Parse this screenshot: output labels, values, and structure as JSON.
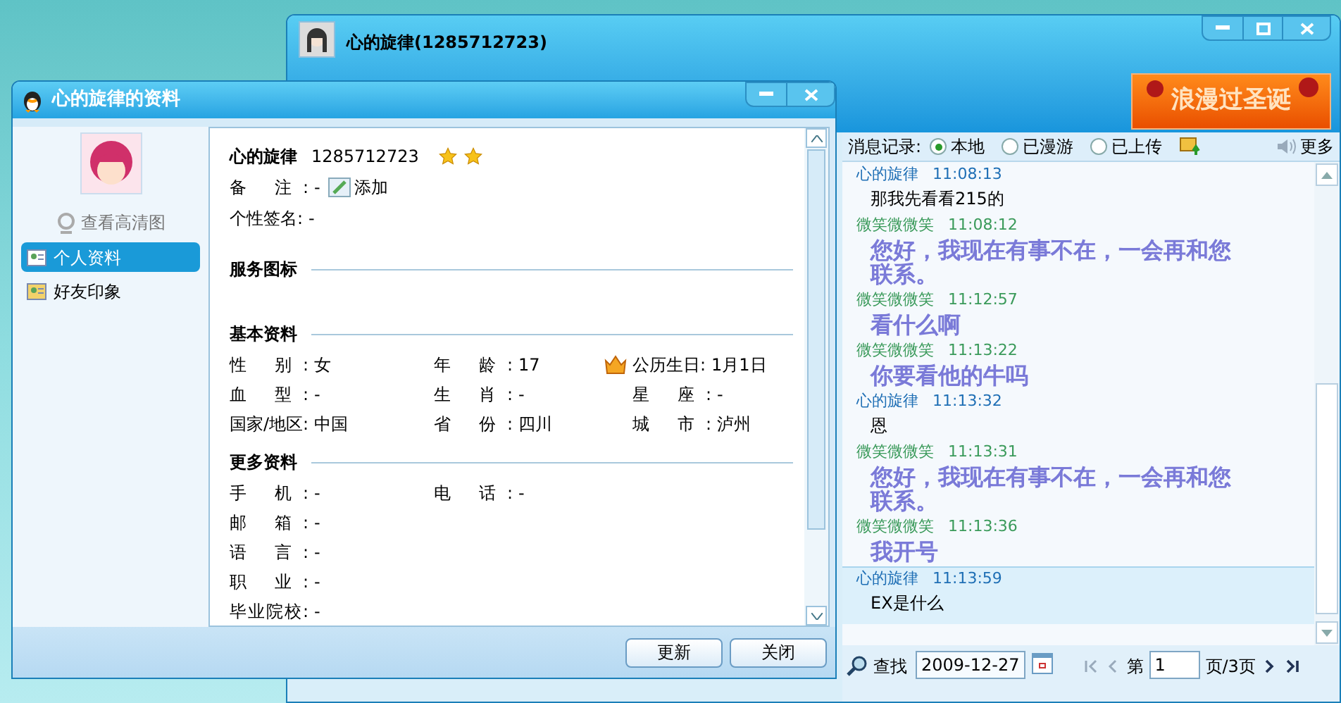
{
  "chat_window": {
    "title": "心的旋律(1285712723)",
    "banner": "浪漫过圣诞",
    "history_bar": {
      "label": "消息记录:",
      "sources": [
        {
          "label": "本地",
          "selected": true
        },
        {
          "label": "已漫游",
          "selected": false
        },
        {
          "label": "已上传",
          "selected": false
        }
      ],
      "more": "更多"
    },
    "messages": [
      {
        "sender": "心的旋律",
        "time": "11:08:13",
        "text": "那我先看看215的",
        "kind": "self",
        "selected": false
      },
      {
        "sender": "微笑微微笑",
        "time": "11:08:12",
        "text": "您好，我现在有事不在，一会再和您联系。",
        "kind": "auto",
        "selected": false
      },
      {
        "sender": "微笑微微笑",
        "time": "11:12:57",
        "text": "看什么啊",
        "kind": "auto",
        "selected": false
      },
      {
        "sender": "微笑微微笑",
        "time": "11:13:22",
        "text": "你要看他的牛吗",
        "kind": "auto",
        "selected": false
      },
      {
        "sender": "心的旋律",
        "time": "11:13:32",
        "text": "恩",
        "kind": "self",
        "selected": false
      },
      {
        "sender": "微笑微微笑",
        "time": "11:13:31",
        "text": "您好，我现在有事不在，一会再和您联系。",
        "kind": "auto",
        "selected": false
      },
      {
        "sender": "微笑微微笑",
        "time": "11:13:36",
        "text": "我开号",
        "kind": "auto",
        "selected": false
      },
      {
        "sender": "心的旋律",
        "time": "11:13:59",
        "text": "EX是什么",
        "kind": "self",
        "selected": true
      }
    ],
    "footer": {
      "search": "查找",
      "date": "2009-12-27",
      "page_prefix": "第",
      "page": "1",
      "page_suffix": "页/3页"
    }
  },
  "profile_dialog": {
    "title": "心的旋律的资料",
    "view_photo": "查看高清图",
    "nav": [
      {
        "label": "个人资料",
        "selected": true
      },
      {
        "label": "好友印象",
        "selected": false
      }
    ],
    "header": {
      "name": "心的旋律",
      "number": "1285712723",
      "rank_icons": [
        {
          "kind": "star"
        },
        {
          "kind": "star"
        }
      ]
    },
    "remark": {
      "label": "备 注:",
      "value": "-",
      "link": "添加"
    },
    "signature": {
      "label": "个性签名:",
      "value": "-"
    },
    "sections": [
      {
        "title": "服务图标"
      },
      {
        "title": "基本资料",
        "rows": [
          [
            {
              "label": "性 别:",
              "value": "女"
            },
            {
              "label": "年 龄:",
              "value": "17"
            },
            {
              "label": "公历生日:",
              "value": "1月1日",
              "kind": "birthday"
            }
          ],
          [
            {
              "label": "血 型:",
              "value": "-"
            },
            {
              "label": "生 肖:",
              "value": "-"
            },
            {
              "label": "星 座:",
              "value": "-"
            }
          ],
          [
            {
              "label": "国家/地区:",
              "value": "中国"
            },
            {
              "label": "省 份:",
              "value": "四川"
            },
            {
              "label": "城 市:",
              "value": "泸州"
            }
          ]
        ]
      },
      {
        "title": "更多资料",
        "rows": [
          [
            {
              "label": "手 机:",
              "value": "-"
            },
            {
              "label": "电 话:",
              "value": "-"
            }
          ],
          [
            {
              "label": "邮 箱:",
              "value": "-"
            }
          ],
          [
            {
              "label": "语 言:",
              "value": "-"
            }
          ],
          [
            {
              "label": "职 业:",
              "value": "-"
            }
          ],
          [
            {
              "label": "毕业院校:",
              "value": "-"
            }
          ]
        ]
      }
    ],
    "buttons": [
      "更新",
      "关闭"
    ]
  }
}
